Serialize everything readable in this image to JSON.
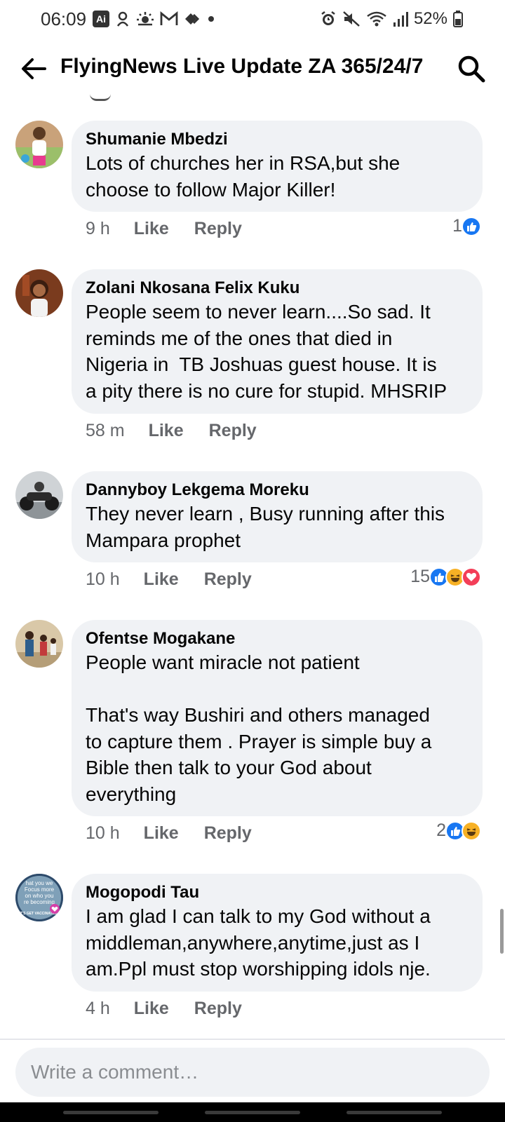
{
  "status_bar": {
    "time": "06:09",
    "ai_badge": "Ai",
    "battery": "52%"
  },
  "header": {
    "title": "FlyingNews Live Update ZA 365/24/7",
    "back_icon": "arrow-left-icon",
    "search_icon": "search-icon"
  },
  "actions": {
    "like": "Like",
    "reply": "Reply"
  },
  "colors": {
    "bubble": "#f0f2f5",
    "meta_text": "#65676b",
    "like_blue": "#1877f2",
    "haha_yellow": "#f7b125",
    "love_red": "#f33e58"
  },
  "comments": [
    {
      "author": "Shumanie Mbedzi",
      "text": "Lots of churches her in RSA,but she\nchoose to follow Major Killer!",
      "time": "9 h",
      "reaction_count": "1",
      "reactions": [
        "like"
      ]
    },
    {
      "author": "Zolani Nkosana Felix Kuku",
      "text": "People seem to never learn....So sad. It\nreminds me of the ones that died in\nNigeria in  TB Joshuas guest house. It is\na pity there is no cure for stupid. MHSRIP",
      "time": "58 m",
      "reaction_count": "",
      "reactions": []
    },
    {
      "author": "Dannyboy Lekgema Moreku",
      "text": "They never learn , Busy running after this\nMampara prophet",
      "time": "10 h",
      "reaction_count": "15",
      "reactions": [
        "like",
        "haha",
        "love"
      ]
    },
    {
      "author": "Ofentse Mogakane",
      "text": "People want miracle not patient\n\nThat's way Bushiri and others managed\nto capture them . Prayer is simple buy a\nBible then talk to your God about\neverything",
      "time": "10 h",
      "reaction_count": "2",
      "reactions": [
        "like",
        "haha"
      ]
    },
    {
      "author": "Mogopodi Tau",
      "text": "I am glad I can talk to my God without a\nmiddleman,anywhere,anytime,just as I\nam.Ppl must stop worshipping idols nje.",
      "time": "4 h",
      "reaction_count": "",
      "reactions": []
    }
  ],
  "avatar_overlay_text": [
    "hat you we",
    "Focus more",
    "on who you",
    "re becoming",
    "LET'S GET VACCINATED"
  ],
  "composer": {
    "placeholder": "Write a comment…"
  }
}
